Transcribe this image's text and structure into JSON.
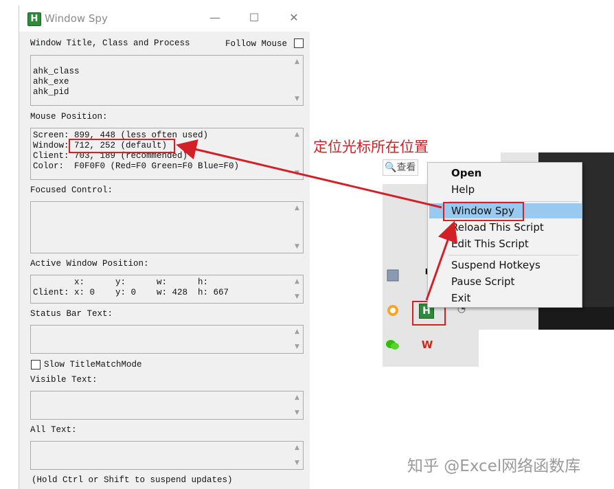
{
  "window_spy": {
    "title": "Window Spy",
    "app_icon_letter": "H",
    "controls": {
      "minimize": "—",
      "maximize": "☐",
      "close": "✕"
    },
    "section_title_class_process": "Window Title, Class and Process",
    "follow_mouse_label": "Follow Mouse",
    "title_box_text": "ahk_class\nahk_exe\nahk_pid",
    "mouse_position_label": "Mouse Position:",
    "mouse_position_text": "Screen: 899, 448 (less often used)\nWindow: 712, 252 (default)\nClient: 703, 189 (recommended)\nColor:  F0F0F0 (Red=F0 Green=F0 Blue=F0)",
    "focused_control_label": "Focused Control:",
    "active_window_position_label": "Active Window Position:",
    "active_window_text": "        x:      y:      w:      h:\nClient: x: 0    y: 0    w: 428  h: 667",
    "status_bar_text_label": "Status Bar Text:",
    "slow_title_match_label": "Slow TitleMatchMode",
    "visible_text_label": "Visible Text:",
    "all_text_label": "All Text:",
    "footer_text": "(Hold Ctrl or Shift to suspend updates)"
  },
  "annotation": {
    "text": "定位光标所在位置",
    "color": "#d32027"
  },
  "tray": {
    "search_button_label": "查看",
    "icons": [
      "window-icon",
      "pin-icon",
      "browser-fox-icon",
      "ahk-h-icon",
      "wifi-icon",
      "wechat-icon",
      "wps-icon"
    ]
  },
  "context_menu": {
    "items": [
      "Open",
      "Help",
      "Window Spy",
      "Reload This Script",
      "Edit This Script",
      "Suspend Hotkeys",
      "Pause Script",
      "Exit"
    ],
    "highlighted": "Window Spy",
    "highlight_color": "#99c9ef"
  },
  "watermark": "知乎 @Excel网络函数库"
}
